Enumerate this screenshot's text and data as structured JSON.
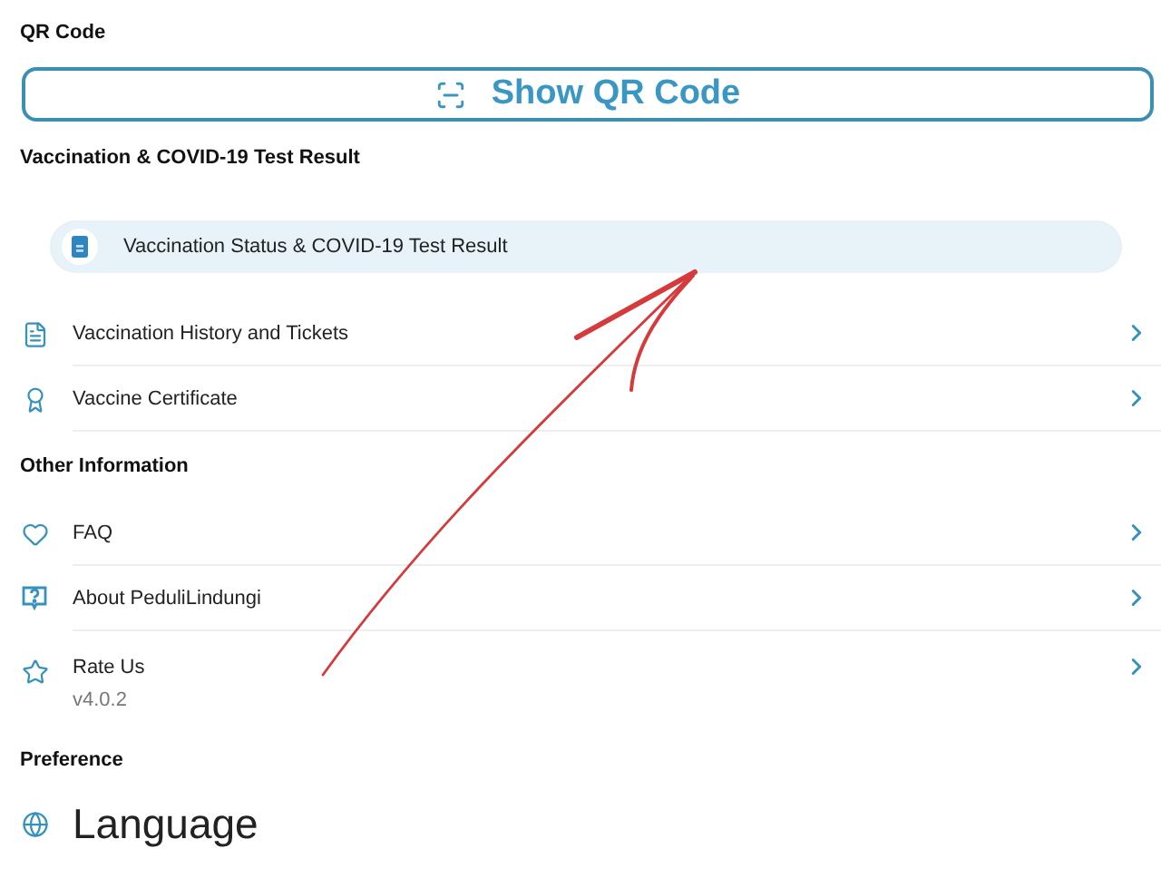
{
  "qr_section": {
    "title": "QR Code",
    "button": {
      "label": "Show QR Code"
    }
  },
  "vaccination_section": {
    "title": "Vaccination & COVID-19 Test Result",
    "highlight_item": {
      "label": "Vaccination Status & COVID-19 Test Result"
    },
    "items": [
      {
        "kind": "history",
        "label": "Vaccination History and Tickets"
      },
      {
        "kind": "certificate",
        "label": "Vaccine Certificate"
      }
    ]
  },
  "other_section": {
    "title": "Other Information",
    "items": [
      {
        "kind": "faq",
        "label": "FAQ"
      },
      {
        "kind": "about",
        "label": "About PeduliLindungi"
      },
      {
        "kind": "rate",
        "label": "Rate Us",
        "subtitle": "v4.0.2"
      }
    ]
  },
  "preference_section": {
    "title": "Preference",
    "items": [
      {
        "kind": "language",
        "label": "Language"
      }
    ]
  },
  "annotation": {
    "kind": "arrow"
  }
}
